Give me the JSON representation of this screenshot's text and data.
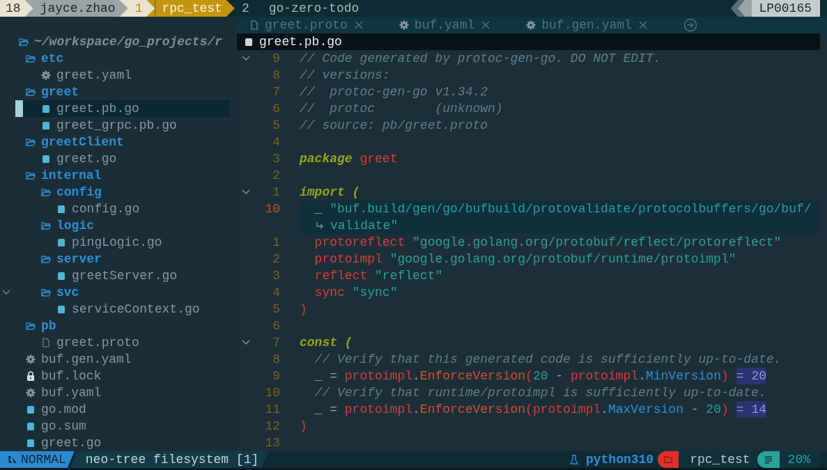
{
  "tmux": {
    "session": "18",
    "user": "jayce.zhao",
    "windows": [
      {
        "index": "1",
        "name": "rpc_test",
        "selected": true
      },
      {
        "index": "2",
        "name": "go-zero-todo",
        "selected": false
      }
    ],
    "host": "LP00165"
  },
  "tabline": {
    "tabs": [
      {
        "label": "greet.proto",
        "kind": "doc",
        "selected": false
      },
      {
        "label": "buf.yaml",
        "kind": "gear",
        "selected": false
      },
      {
        "label": "buf.gen.yaml",
        "kind": "gear",
        "selected": false
      }
    ]
  },
  "explorer": {
    "root": "~/workspace/go_projects/r",
    "items": [
      {
        "name": "etc",
        "kind": "folder",
        "children": [
          {
            "name": "greet.yaml",
            "kind": "gear",
            "selected": false
          }
        ]
      },
      {
        "name": "greet",
        "kind": "folder",
        "children": [
          {
            "name": "greet.pb.go",
            "kind": "go",
            "selected": true
          },
          {
            "name": "greet_grpc.pb.go",
            "kind": "go",
            "selected": false
          }
        ]
      },
      {
        "name": "greetClient",
        "kind": "folder",
        "children": [
          {
            "name": "greet.go",
            "kind": "go",
            "selected": false
          }
        ]
      },
      {
        "name": "internal",
        "kind": "folder",
        "children": [
          {
            "name": "config",
            "kind": "folder",
            "children": [
              {
                "name": "config.go",
                "kind": "go",
                "selected": false
              }
            ]
          },
          {
            "name": "logic",
            "kind": "folder",
            "children": [
              {
                "name": "pingLogic.go",
                "kind": "go",
                "selected": false
              }
            ]
          },
          {
            "name": "server",
            "kind": "folder",
            "children": [
              {
                "name": "greetServer.go",
                "kind": "go",
                "selected": false
              }
            ]
          },
          {
            "name": "svc",
            "kind": "folder",
            "fold_marker": true,
            "children": [
              {
                "name": "serviceContext.go",
                "kind": "go",
                "selected": false
              }
            ]
          }
        ]
      },
      {
        "name": "pb",
        "kind": "folder",
        "children": [
          {
            "name": "greet.proto",
            "kind": "doc",
            "selected": false
          }
        ]
      },
      {
        "name": "buf.gen.yaml",
        "kind": "gear",
        "selected": false
      },
      {
        "name": "buf.lock",
        "kind": "lock",
        "selected": false
      },
      {
        "name": "buf.yaml",
        "kind": "gear",
        "selected": false
      },
      {
        "name": "go.mod",
        "kind": "go",
        "selected": false
      },
      {
        "name": "go.sum",
        "kind": "go",
        "selected": false
      },
      {
        "name": "greet.go",
        "kind": "go",
        "selected": false
      }
    ]
  },
  "winbar": {
    "file": "greet.pb.go"
  },
  "editor": {
    "lines": [
      {
        "number": "9",
        "fold": true,
        "current": false,
        "tokens": [
          {
            "kind": "comment",
            "text": "// Code generated by protoc-gen-go. DO NOT EDIT."
          }
        ]
      },
      {
        "number": "8",
        "fold": false,
        "current": false,
        "tokens": [
          {
            "kind": "comment",
            "text": "// versions:"
          }
        ]
      },
      {
        "number": "7",
        "fold": false,
        "current": false,
        "tokens": [
          {
            "kind": "comment",
            "text": "// \tprotoc-gen-go v1.34.2"
          }
        ]
      },
      {
        "number": "6",
        "fold": false,
        "current": false,
        "tokens": [
          {
            "kind": "comment",
            "text": "// \tprotoc        (unknown)"
          }
        ]
      },
      {
        "number": "5",
        "fold": false,
        "current": false,
        "tokens": [
          {
            "kind": "comment",
            "text": "// source: pb/greet.proto"
          }
        ]
      },
      {
        "number": "4",
        "fold": false,
        "current": false
      },
      {
        "number": "3",
        "fold": false,
        "current": false,
        "tokens": [
          {
            "kind": "keyword",
            "text": "package "
          },
          {
            "kind": "ident",
            "text": "greet"
          }
        ]
      },
      {
        "number": "2",
        "fold": false,
        "current": false
      },
      {
        "number": "1",
        "fold": true,
        "current": false,
        "tokens": [
          {
            "kind": "keyword",
            "text": "import ("
          }
        ]
      },
      {
        "number": "10",
        "fold": false,
        "current": true,
        "tokens": [
          {
            "kind": "plain",
            "text": "  _ "
          },
          {
            "kind": "string",
            "text": "\"buf.build/gen/go/bufbuild/protovalidate/protocolbuffers/go/buf/"
          }
        ]
      },
      {
        "wrap": true,
        "fold": false,
        "current": true,
        "tokens": [
          {
            "kind": "string",
            "text": "validate\""
          }
        ]
      },
      {
        "number": "1",
        "fold": false,
        "current": false,
        "tokens": [
          {
            "kind": "ident",
            "text": "  protoreflect "
          },
          {
            "kind": "string",
            "text": "\"google.golang.org/protobuf/reflect/protoreflect\""
          }
        ]
      },
      {
        "number": "2",
        "fold": false,
        "current": false,
        "tokens": [
          {
            "kind": "ident",
            "text": "  protoimpl "
          },
          {
            "kind": "string",
            "text": "\"google.golang.org/protobuf/runtime/protoimpl\""
          }
        ]
      },
      {
        "number": "3",
        "fold": false,
        "current": false,
        "tokens": [
          {
            "kind": "ident",
            "text": "  reflect "
          },
          {
            "kind": "string",
            "text": "\"reflect\""
          }
        ]
      },
      {
        "number": "4",
        "fold": false,
        "current": false,
        "tokens": [
          {
            "kind": "ident",
            "text": "  sync "
          },
          {
            "kind": "string",
            "text": "\"sync\""
          }
        ]
      },
      {
        "number": "5",
        "fold": false,
        "current": false,
        "tokens": [
          {
            "kind": "ident",
            "text": ")"
          }
        ]
      },
      {
        "number": "6",
        "fold": false,
        "current": false
      },
      {
        "number": "7",
        "fold": true,
        "current": false,
        "tokens": [
          {
            "kind": "keyword",
            "text": "const ("
          }
        ]
      },
      {
        "number": "8",
        "fold": false,
        "current": false,
        "tokens": [
          {
            "kind": "comment",
            "text": "  // Verify that this generated code is sufficiently up-to-date."
          }
        ]
      },
      {
        "number": "9",
        "fold": false,
        "current": false,
        "hint": "= 20",
        "tokens": [
          {
            "kind": "plain",
            "text": "  _ = "
          },
          {
            "kind": "ident",
            "text": "protoimpl"
          },
          {
            "kind": "plain",
            "text": "."
          },
          {
            "kind": "func",
            "text": "EnforceVersion"
          },
          {
            "kind": "ident",
            "text": "("
          },
          {
            "kind": "number",
            "text": "20"
          },
          {
            "kind": "plain",
            "text": " - "
          },
          {
            "kind": "ident",
            "text": "protoimpl"
          },
          {
            "kind": "plain",
            "text": "."
          },
          {
            "kind": "field",
            "text": "MinVersion"
          },
          {
            "kind": "ident",
            "text": ")"
          }
        ]
      },
      {
        "number": "10",
        "fold": false,
        "current": false,
        "tokens": [
          {
            "kind": "comment",
            "text": "  // Verify that runtime/protoimpl is sufficiently up-to-date."
          }
        ]
      },
      {
        "number": "11",
        "fold": false,
        "current": false,
        "hint": "= 14",
        "tokens": [
          {
            "kind": "plain",
            "text": "  _ = "
          },
          {
            "kind": "ident",
            "text": "protoimpl"
          },
          {
            "kind": "plain",
            "text": "."
          },
          {
            "kind": "func",
            "text": "EnforceVersion"
          },
          {
            "kind": "ident",
            "text": "("
          },
          {
            "kind": "ident",
            "text": "protoimpl"
          },
          {
            "kind": "plain",
            "text": "."
          },
          {
            "kind": "field",
            "text": "MaxVersion"
          },
          {
            "kind": "plain",
            "text": " - "
          },
          {
            "kind": "number",
            "text": "20"
          },
          {
            "kind": "ident",
            "text": ")"
          }
        ]
      },
      {
        "number": "12",
        "fold": false,
        "current": false,
        "tokens": [
          {
            "kind": "ident",
            "text": ")"
          }
        ]
      },
      {
        "number": "13",
        "fold": false,
        "current": false
      }
    ]
  },
  "statusline": {
    "mode": "NORMAL",
    "buffer": "neo-tree filesystem [1]",
    "env": "python310",
    "cwd": "rpc_test",
    "progress": "20%"
  }
}
